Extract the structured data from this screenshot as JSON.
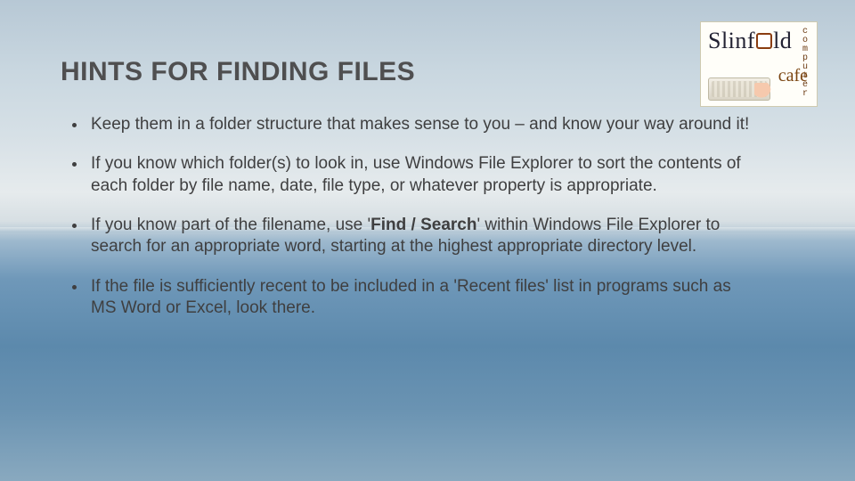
{
  "title": "HINTS FOR FINDING FILES",
  "bullets": [
    {
      "pre": "Keep them in a folder structure that makes sense to you – and know your way around it!",
      "bold": "",
      "post": ""
    },
    {
      "pre": "If you know which folder(s) to look in, use Windows File Explorer to sort the contents of each folder by file name, date, file type, or whatever property is appropriate.",
      "bold": "",
      "post": ""
    },
    {
      "pre": "If you know part of the filename, use '",
      "bold": "Find / Search",
      "post": "' within Windows File Explorer to search for an appropriate word, starting at the highest appropriate directory level."
    },
    {
      "pre": "If the file is sufficiently recent to be included in a 'Recent files' list in programs such as MS Word or Excel, look there.",
      "bold": "",
      "post": ""
    }
  ],
  "logo": {
    "word": "Slinf",
    "word2": "ld",
    "vertical": "computer",
    "script": "cafe"
  }
}
